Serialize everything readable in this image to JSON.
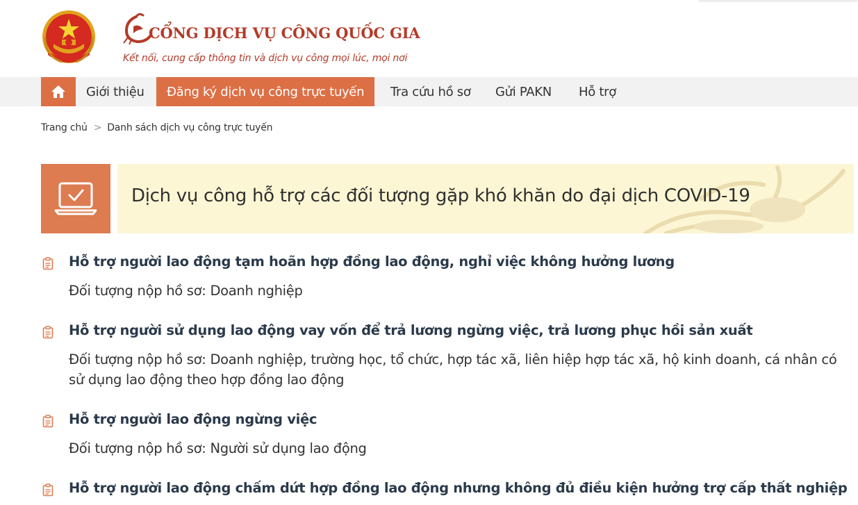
{
  "header": {
    "title": "CỔNG DỊCH VỤ CÔNG QUỐC GIA",
    "slogan": "Kết nối, cung cấp thông tin và dịch vụ công mọi lúc, mọi nơi",
    "emblem_icon": "national-emblem-icon",
    "logo_icon": "crane-logo-icon"
  },
  "colors": {
    "brand": "#b33a28",
    "accent": "#dd6f45",
    "banner_bg": "#fdf6d4",
    "nav_bg": "#f2f2f2"
  },
  "nav": {
    "home_icon": "home-icon",
    "items": [
      {
        "label": "Giới thiệu",
        "active": false
      },
      {
        "label": "Đăng ký dịch vụ công trực tuyến",
        "active": true
      },
      {
        "label": "Tra cứu hồ sơ",
        "active": false
      },
      {
        "label": "Gửi PAKN",
        "active": false
      },
      {
        "label": "Hỗ trợ",
        "active": false
      }
    ]
  },
  "breadcrumb": {
    "home": "Trang chủ",
    "separator": ">",
    "current": "Danh sách dịch vụ công trực tuyến"
  },
  "banner": {
    "icon": "laptop-check-icon",
    "title": "Dịch vụ công hỗ trợ các đối tượng gặp khó khăn do đại dịch COVID-19"
  },
  "services": [
    {
      "title": "Hỗ trợ người lao động tạm hoãn hợp đồng lao động, nghỉ việc không hưởng lương",
      "desc": "Đối tượng nộp hồ sơ: Doanh nghiệp"
    },
    {
      "title": "Hỗ trợ người sử dụng lao động vay vốn để trả lương ngừng việc, trả lương phục hồi sản xuất",
      "desc": "Đối tượng nộp hồ sơ: Doanh nghiệp, trường học, tổ chức, hợp tác xã, liên hiệp hợp tác xã, hộ kinh doanh, cá nhân có sử dụng lao động theo hợp đồng lao động"
    },
    {
      "title": "Hỗ trợ người lao động ngừng việc",
      "desc": "Đối tượng nộp hồ sơ: Người sử dụng lao động"
    },
    {
      "title": "Hỗ trợ người lao động chấm dứt hợp đồng lao động nhưng không đủ điều kiện hưởng trợ cấp thất nghiệp",
      "desc": ""
    }
  ]
}
